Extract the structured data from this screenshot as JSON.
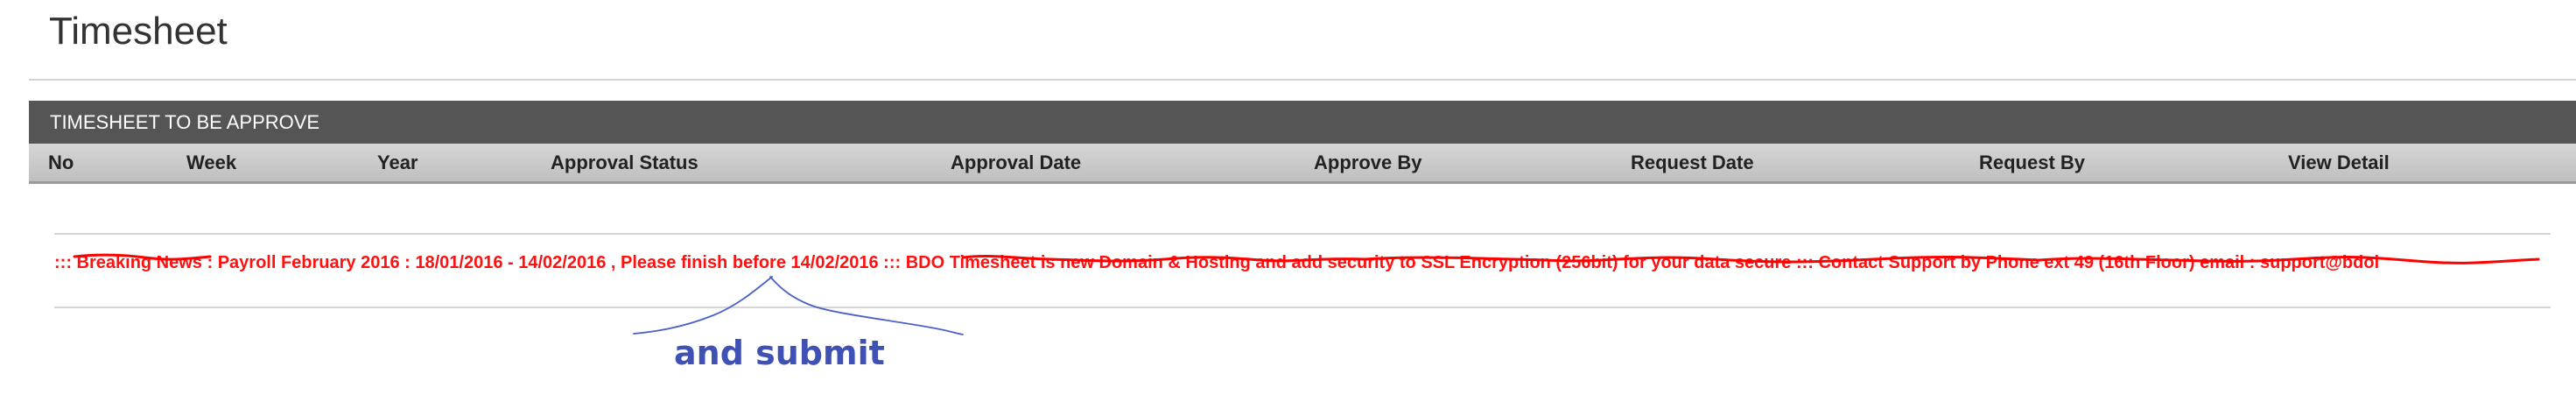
{
  "page": {
    "title": "Timesheet"
  },
  "panel": {
    "header": "TIMESHEET TO BE APPROVE",
    "columns": [
      "No",
      "Week",
      "Year",
      "Approval Status",
      "Approval Date",
      "Approve By",
      "Request Date",
      "Request By",
      "View Detail"
    ]
  },
  "news": {
    "ticker": "::: Breaking News : Payroll February 2016 : 18/01/2016 - 14/02/2016 , Please finish before 14/02/2016 ::: BDO Timesheet is new Domain & Hosting and add security to SSL Encryption (256bit) for your data secure ::: Contact Support by Phone ext 49 (16th Floor) email : support@bdoi"
  },
  "annotation": {
    "label": "and submit",
    "label_color": "#3f51b5",
    "marker_color": "#ff0000"
  },
  "colors": {
    "header_bg": "#555555",
    "ticker_text": "#ff1111"
  }
}
